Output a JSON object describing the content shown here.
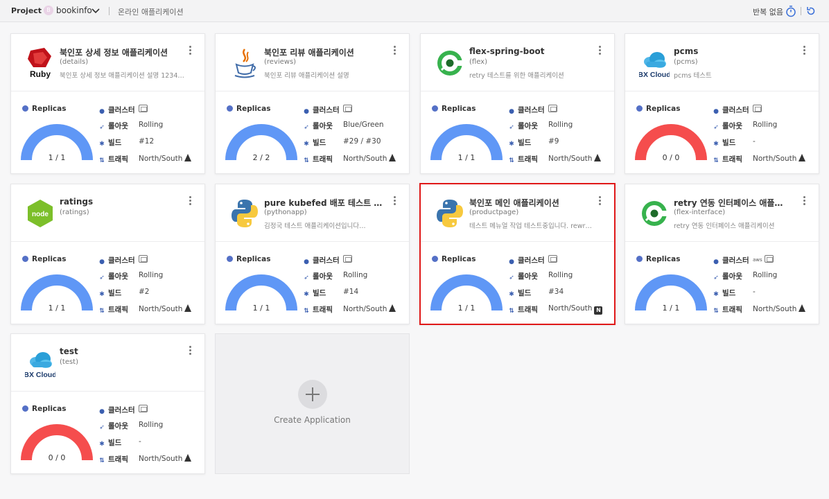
{
  "topbar": {
    "project_label": "Project :",
    "project_icon_text": "B",
    "project_name": "bookinfo",
    "app_name": "온라인 애플리케이션",
    "repeat_label": "반복 없음"
  },
  "labels": {
    "replicas": "Replicas",
    "cluster": "클러스터",
    "rollout": "롤아웃",
    "build": "빌드",
    "traffic": "트래픽"
  },
  "cards": [
    {
      "title": "북인포 상세 정보 애플리케이션",
      "sub": "(details)",
      "desc": "북인포 상세 정보 애플리케이션 설명 1234…",
      "logo": "ruby-logo",
      "logo_text": "Ruby",
      "replicas": "1 / 1",
      "replica_ratio": 1,
      "gauge_color": "#5f97f6",
      "rollout": "Rolling",
      "build": "#12",
      "traffic": "North/South",
      "traffic_icon": "sail-icon"
    },
    {
      "title": "북인포 리뷰 애플리케이션",
      "sub": "(reviews)",
      "desc": "북인포 리뷰 애플리케이션 설명",
      "logo": "java-logo",
      "logo_text": "",
      "replicas": "2 / 2",
      "replica_ratio": 1,
      "gauge_color": "#5f97f6",
      "rollout": "Blue/Green",
      "build": "#29 / #30",
      "traffic": "North/South",
      "traffic_icon": "sail-icon"
    },
    {
      "title": "flex-spring-boot",
      "sub": "(flex)",
      "desc": "retry 테스트를 위한 애플리케이션",
      "logo": "concourse-logo",
      "logo_text": "",
      "replicas": "1 / 1",
      "replica_ratio": 1,
      "gauge_color": "#5f97f6",
      "rollout": "Rolling",
      "build": "#9",
      "traffic": "North/South",
      "traffic_icon": "sail-icon"
    },
    {
      "title": "pcms",
      "sub": "(pcms)",
      "desc": "pcms 테스트",
      "logo": "bxcloud-logo",
      "logo_text": "BX Cloud",
      "replicas": "0 / 0",
      "replica_ratio": 1,
      "gauge_color": "#f54d4d",
      "rollout": "Rolling",
      "build": "-",
      "traffic": "North/South",
      "traffic_icon": "sail-icon"
    },
    {
      "title": "ratings",
      "sub": "(ratings)",
      "desc": "",
      "logo": "node-logo",
      "logo_text": "node",
      "replicas": "1 / 1",
      "replica_ratio": 1,
      "gauge_color": "#5f97f6",
      "rollout": "Rolling",
      "build": "#2",
      "traffic": "North/South",
      "traffic_icon": "sail-icon"
    },
    {
      "title": "pure kubefed 배포 테스트 …",
      "sub": "(pythonapp)",
      "desc": "김정국 테스트 애플리케이션입니다…",
      "logo": "python-logo",
      "logo_text": "",
      "replicas": "1 / 1",
      "replica_ratio": 1,
      "gauge_color": "#5f97f6",
      "rollout": "Rolling",
      "build": "#14",
      "traffic": "North/South",
      "traffic_icon": "sail-icon"
    },
    {
      "title": "북인포 메인 애플리케이션",
      "sub": "(productpage)",
      "desc": "테스트 메뉴얼 작업 테스트중입니다. rewr…",
      "logo": "python-logo",
      "logo_text": "",
      "replicas": "1 / 1",
      "replica_ratio": 1,
      "gauge_color": "#5f97f6",
      "rollout": "Rolling",
      "build": "#34",
      "traffic": "North/South",
      "traffic_icon": "nginx-icon",
      "nginx_text": "N",
      "highlight": true
    },
    {
      "title": "retry 연동 인터페이스 애플…",
      "sub": "(flex-interface)",
      "desc": "retry 연동 인터페이스 애플리케이션",
      "logo": "concourse-logo",
      "logo_text": "",
      "replicas": "1 / 1",
      "replica_ratio": 1,
      "gauge_color": "#5f97f6",
      "rollout": "Rolling",
      "build": "-",
      "traffic": "North/South",
      "traffic_icon": "sail-icon",
      "aws_text": "aws"
    },
    {
      "title": "test",
      "sub": "(test)",
      "desc": "",
      "logo": "bxcloud-logo",
      "logo_text": "BX Cloud",
      "replicas": "0 / 0",
      "replica_ratio": 1,
      "gauge_color": "#f54d4d",
      "rollout": "Rolling",
      "build": "-",
      "traffic": "North/South",
      "traffic_icon": "sail-icon"
    }
  ],
  "create": {
    "label": "Create Application"
  }
}
